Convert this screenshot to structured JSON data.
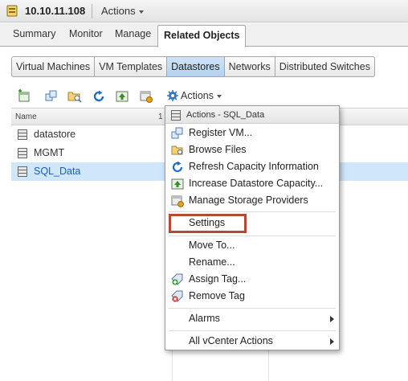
{
  "titlebar": {
    "host": "10.10.11.108",
    "actions_label": "Actions"
  },
  "tabs": [
    {
      "label": "Summary",
      "active": false
    },
    {
      "label": "Monitor",
      "active": false
    },
    {
      "label": "Manage",
      "active": false
    },
    {
      "label": "Related Objects",
      "active": true
    }
  ],
  "subtabs": [
    {
      "label": "Virtual Machines",
      "active": false
    },
    {
      "label": "VM Templates",
      "active": false
    },
    {
      "label": "Datastores",
      "active": true
    },
    {
      "label": "Networks",
      "active": false
    },
    {
      "label": "Distributed Switches",
      "active": false
    }
  ],
  "toolbar": {
    "actions_label": "Actions"
  },
  "grid": {
    "columns": {
      "name": "Name",
      "col2": "1"
    },
    "rows": [
      {
        "label": "datastore",
        "selected": false
      },
      {
        "label": "MGMT",
        "selected": false
      },
      {
        "label": "SQL_Data",
        "selected": true
      }
    ]
  },
  "menu": {
    "header": "Actions - SQL_Data",
    "items": [
      {
        "label": "Register VM...",
        "icon": "register-vm-icon"
      },
      {
        "label": "Browse Files",
        "icon": "folder-search-icon"
      },
      {
        "label": "Refresh Capacity Information",
        "icon": "refresh-icon"
      },
      {
        "label": "Increase Datastore Capacity...",
        "icon": "increase-capacity-icon"
      },
      {
        "label": "Manage Storage Providers",
        "icon": "storage-providers-icon"
      },
      {
        "label": "Settings",
        "icon": ""
      },
      {
        "label": "Move To...",
        "icon": ""
      },
      {
        "label": "Rename...",
        "icon": ""
      },
      {
        "label": "Assign Tag...",
        "icon": "assign-tag-icon"
      },
      {
        "label": "Remove Tag",
        "icon": "remove-tag-icon"
      },
      {
        "label": "Alarms",
        "icon": "",
        "submenu": true
      },
      {
        "label": "All vCenter Actions",
        "icon": "",
        "submenu": true
      }
    ],
    "highlighted_item": "Settings",
    "highlight_color": "#b34a34"
  },
  "colors": {
    "selected_row": "#cfe6fb",
    "active_subtab": "#b4d2ef",
    "link_blue": "#1a5fb4"
  }
}
